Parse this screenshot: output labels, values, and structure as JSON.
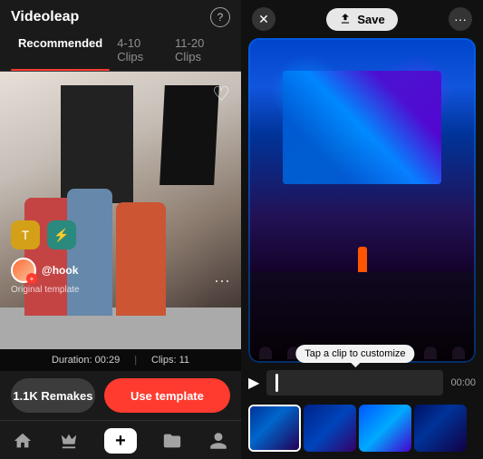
{
  "app": {
    "title": "Videoleap",
    "help_label": "?"
  },
  "left_panel": {
    "tabs": [
      {
        "id": "recommended",
        "label": "Recommended",
        "active": true
      },
      {
        "id": "4-10",
        "label": "4-10 Clips",
        "active": false
      },
      {
        "id": "11-20",
        "label": "11-20 Clips",
        "active": false
      }
    ],
    "video": {
      "username": "@hook",
      "original_label": "Original template",
      "duration_label": "Duration: 00:29",
      "clips_label": "Clips: 11"
    },
    "actions": {
      "remakes_label": "1.1K Remakes",
      "use_template_label": "Use template"
    },
    "nav": {
      "home_icon": "⌂",
      "crown_icon": "♛",
      "add_icon": "+",
      "folder_icon": "⊞",
      "profile_icon": "◯"
    }
  },
  "right_panel": {
    "save_label": "Save",
    "timeline": {
      "tooltip": "Tap a clip to customize",
      "time_display": "00:00",
      "play_icon": "▶"
    }
  }
}
